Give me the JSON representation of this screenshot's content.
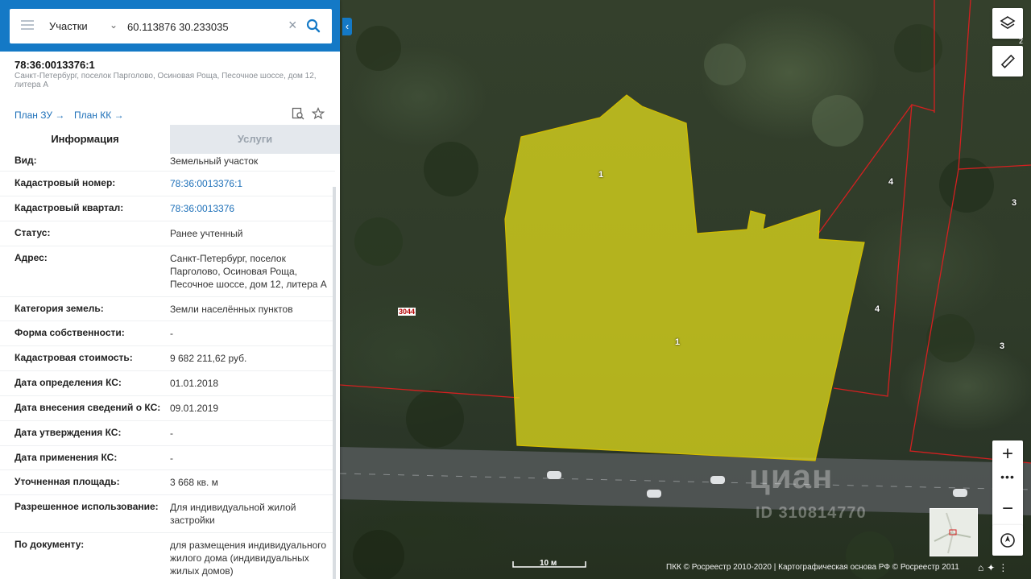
{
  "search": {
    "type_label": "Участки",
    "value": "60.113876 30.233035"
  },
  "card": {
    "title": "78:36:0013376:1",
    "subtitle": "Санкт-Петербург, поселок Парголово, Осиновая Роща, Песочное шоссе, дом 12, литера А",
    "plan_zu": "План ЗУ",
    "plan_kk": "План КК"
  },
  "tabs": {
    "info": "Информация",
    "services": "Услуги"
  },
  "rows": [
    {
      "k": "Вид:",
      "v": "Земельный участок"
    },
    {
      "k": "Кадастровый номер:",
      "v": "78:36:0013376:1"
    },
    {
      "k": "Кадастровый квартал:",
      "v": "78:36:0013376"
    },
    {
      "k": "Статус:",
      "v": "Ранее учтенный"
    },
    {
      "k": "Адрес:",
      "v": "Санкт-Петербург, поселок Парголово, Осиновая Роща, Песочное шоссе, дом 12, литера А"
    },
    {
      "k": "Категория земель:",
      "v": "Земли населённых пунктов"
    },
    {
      "k": "Форма собственности:",
      "v": "-"
    },
    {
      "k": "Кадастровая стоимость:",
      "v": "9 682 211,62 руб."
    },
    {
      "k": "Дата определения КС:",
      "v": "01.01.2018"
    },
    {
      "k": "Дата внесения сведений о КС:",
      "v": "09.01.2019"
    },
    {
      "k": "Дата утверждения КС:",
      "v": "-"
    },
    {
      "k": "Дата применения КС:",
      "v": "-"
    },
    {
      "k": "Уточненная площадь:",
      "v": "3 668 кв. м"
    },
    {
      "k": "Разрешенное использование:",
      "v": "Для индивидуальной жилой застройки"
    },
    {
      "k": "По документу:",
      "v": "для размещения индивидуального жилого дома (индивидуальных жилых домов)"
    }
  ],
  "map": {
    "labels": {
      "parcel_1a": "1",
      "parcel_1b": "1",
      "parcel_4a": "4",
      "parcel_4b": "4",
      "parcel_3a": "3",
      "parcel_3b": "3",
      "block": "3044"
    },
    "layers_badge": "2",
    "scale": "10 м",
    "copyright": "ПКК © Росреестр 2010-2020 | Картографическая основа РФ © Росреестр 2011",
    "watermark": "циан",
    "watermark_id": "ID 310814770",
    "zoom_in": "+",
    "zoom_more": "•••",
    "zoom_out": "−",
    "parcel_fill": "#e8e21a",
    "boundary_color": "#d42020"
  },
  "colors": {
    "header_blue": "#1479c6",
    "link_blue": "#1c6fb8"
  },
  "icons": {
    "menu": "menu-icon",
    "search": "search-icon",
    "clear": "close-icon",
    "layers": "layers-icon",
    "ruler": "ruler-icon",
    "compass": "compass-icon",
    "star": "star-icon",
    "map_search": "map-search-icon"
  }
}
